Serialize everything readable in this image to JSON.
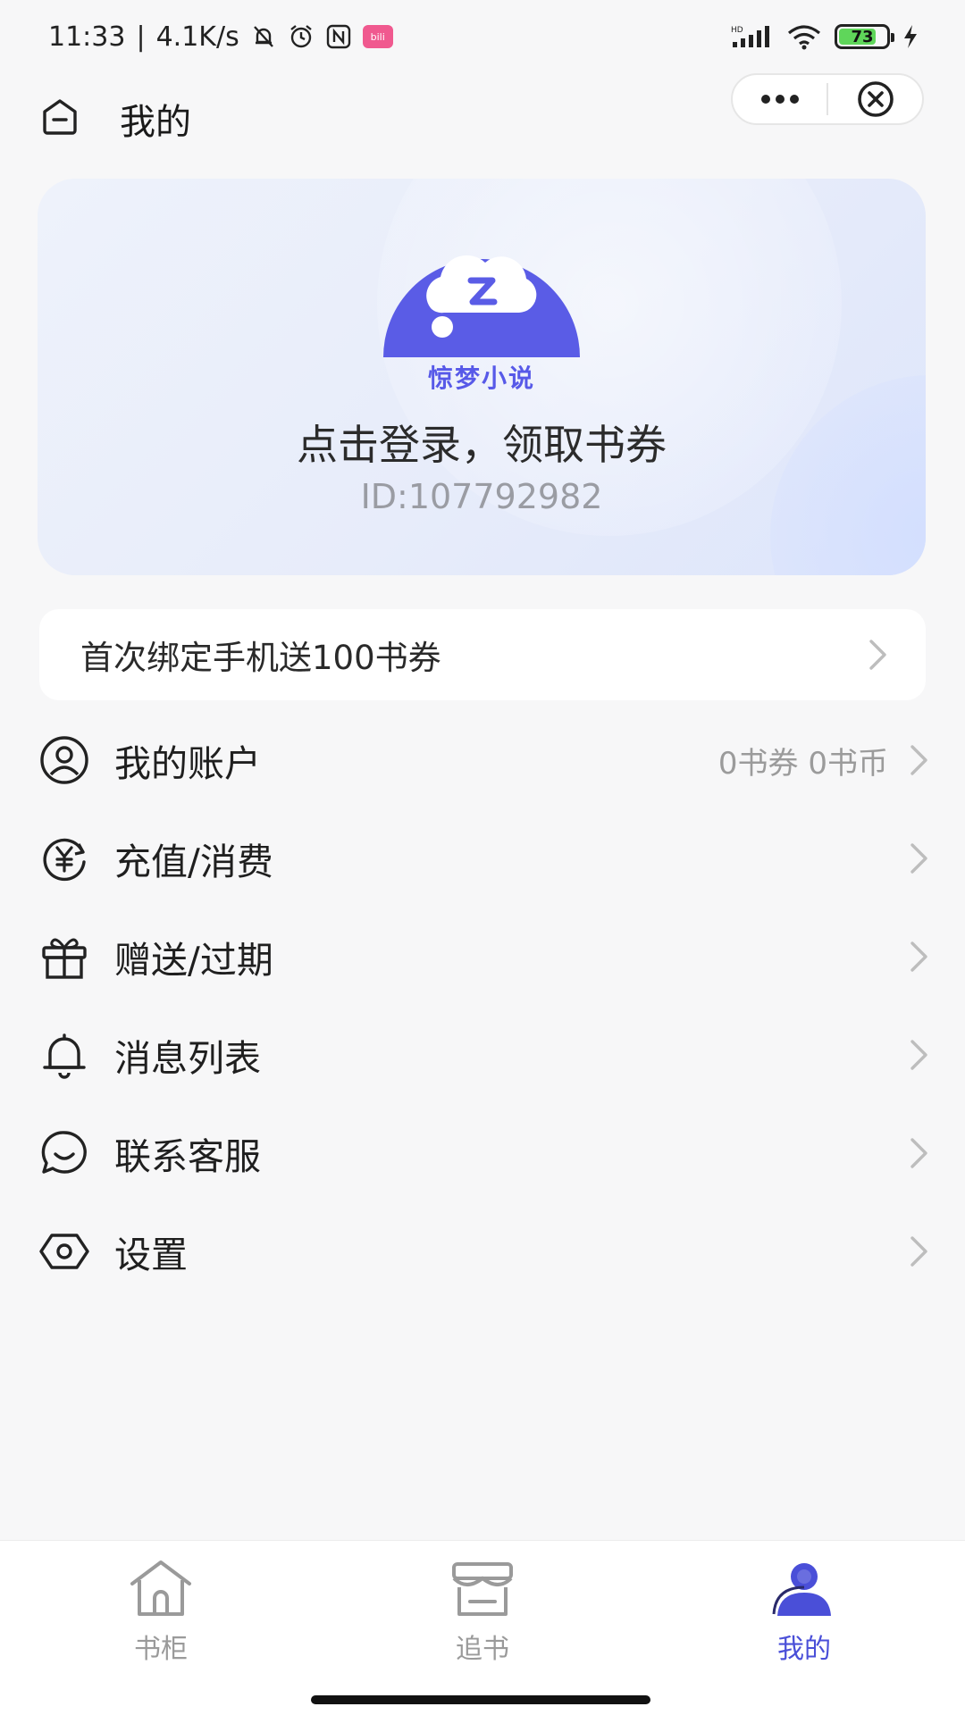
{
  "status_bar": {
    "time": "11:33",
    "net_speed": "4.1K/s",
    "battery": "73",
    "app_badge": "bili"
  },
  "header": {
    "title": "我的",
    "home_icon": "home-minus-icon",
    "more_icon": "more-dots-icon",
    "close_icon": "close-circle-icon"
  },
  "profile": {
    "logo_text": "惊梦小说",
    "login_prompt": "点击登录，领取书券",
    "user_id": "ID:107792982",
    "brand_color": "#5a5ce6"
  },
  "promo": {
    "label": "首次绑定手机送100书券"
  },
  "menu": {
    "items": [
      {
        "label": "我的账户",
        "value": "0书券 0书币",
        "icon": "user-circle-icon"
      },
      {
        "label": "充值/消费",
        "value": "",
        "icon": "yen-cycle-icon"
      },
      {
        "label": "赠送/过期",
        "value": "",
        "icon": "gift-icon"
      },
      {
        "label": "消息列表",
        "value": "",
        "icon": "bell-icon"
      },
      {
        "label": "联系客服",
        "value": "",
        "icon": "chat-smile-icon"
      },
      {
        "label": "设置",
        "value": "",
        "icon": "settings-hexagon-icon"
      }
    ]
  },
  "tabs": [
    {
      "label": "书柜",
      "icon": "house-icon",
      "active": false
    },
    {
      "label": "追书",
      "icon": "store-icon",
      "active": false
    },
    {
      "label": "我的",
      "icon": "profile-icon",
      "active": true
    }
  ],
  "colors": {
    "accent": "#4a4fd8",
    "background": "#f7f7f8"
  }
}
